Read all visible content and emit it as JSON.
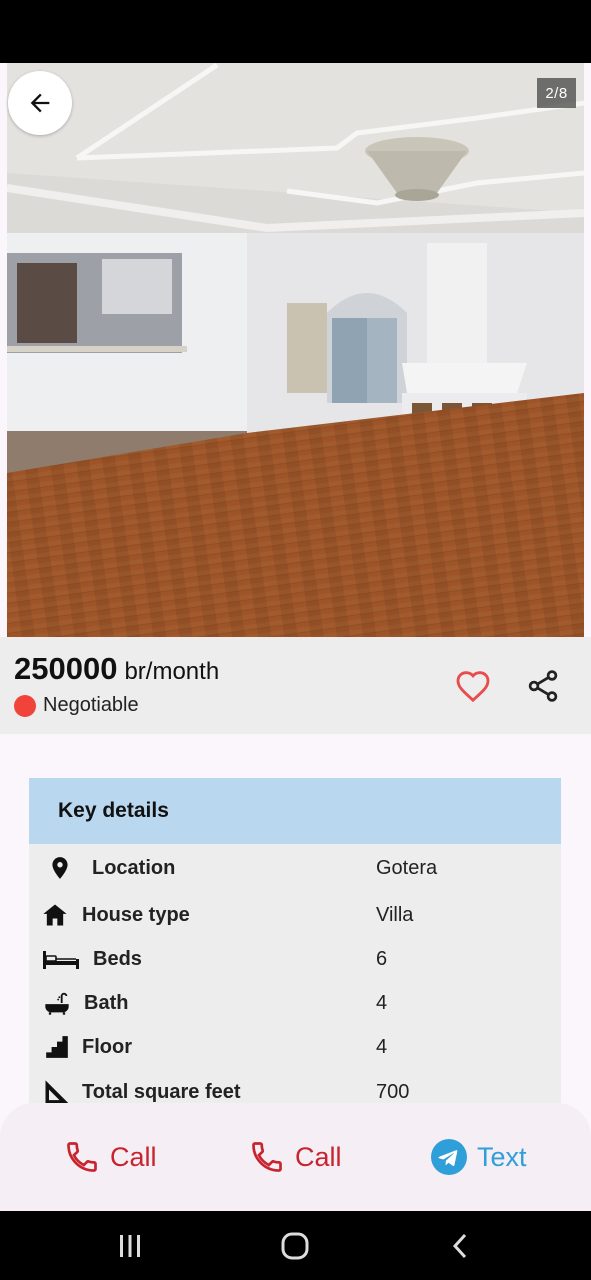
{
  "gallery": {
    "counter": "2/8"
  },
  "listing": {
    "price": "250000",
    "price_unit": "br/month",
    "negotiable_label": "Negotiable",
    "negotiable_color": "#f0443a"
  },
  "details": {
    "title": "Key details",
    "rows": [
      {
        "icon": "location-pin-icon",
        "label": "Location",
        "value": "Gotera"
      },
      {
        "icon": "house-icon",
        "label": "House type",
        "value": "Villa"
      },
      {
        "icon": "bed-icon",
        "label": "Beds",
        "value": "6"
      },
      {
        "icon": "bathtub-icon",
        "label": "Bath",
        "value": "4"
      },
      {
        "icon": "stairs-icon",
        "label": "Floor",
        "value": "4"
      },
      {
        "icon": "set-square-icon",
        "label": "Total square feet",
        "value": "700"
      }
    ]
  },
  "actions": {
    "call_1": "Call",
    "call_2": "Call",
    "text": "Text"
  },
  "colors": {
    "header_band": "#b9d7ef",
    "call_red": "#c8242e",
    "text_blue": "#2f9fd9",
    "favorite_red": "#e84c4c"
  }
}
